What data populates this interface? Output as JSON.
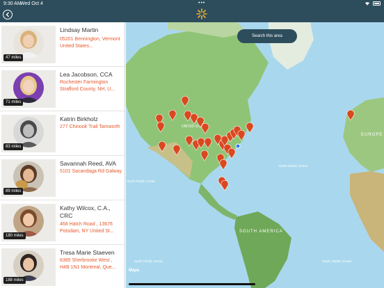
{
  "status": {
    "time": "9:30 AM",
    "date": "Wed Oct 4",
    "dots": "•••"
  },
  "colors": {
    "nav_bg": "#2e4d5c",
    "accent": "#e6582b",
    "pin": "#d9481f"
  },
  "icons": {
    "back": "chevron-left-icon",
    "logo": "sunburst-logo-icon",
    "wifi": "wifi-icon",
    "battery": "battery-icon",
    "pin": "map-pin-icon"
  },
  "providers": [
    {
      "name": "Lindsay Martin",
      "address": "05201 Bennington, Vermont United States...",
      "distance": "47 miles"
    },
    {
      "name": "Lea Jacobson, CCA",
      "address": "Rochester Farmington Strafford County, NH, U...",
      "distance": "71 miles"
    },
    {
      "name": "Katrin Birkholz",
      "address": "277 Chinook Trail Tamworth",
      "distance": "83 miles"
    },
    {
      "name": "Savannah Reed, AVA",
      "address": "5101 Sacandaga Rd Galway",
      "distance": "89 miles"
    },
    {
      "name": "Kathy Wilcox, C.A., CRC",
      "address": "468 Hatch Road , 13676 Potsdam, NY United St...",
      "distance": "180 miles"
    },
    {
      "name": "Tresa Marie Staeven",
      "address": "6385 Sherbrooke West , H4B 1N1 Montreal, Que...",
      "distance": "188 miles"
    }
  ],
  "map": {
    "search_button": "Search this area",
    "attribution": "Maps",
    "labels": {
      "na_country": "UNITED STATES",
      "europe": "EUROPE",
      "south_america": "SOUTH AMERICA",
      "north_atlantic": "North Atlantic Ocean",
      "north_pacific": "North Pacific Ocean",
      "south_pacific": "South Pacific Ocean",
      "south_atlantic": "South Atlantic Ocean"
    }
  }
}
